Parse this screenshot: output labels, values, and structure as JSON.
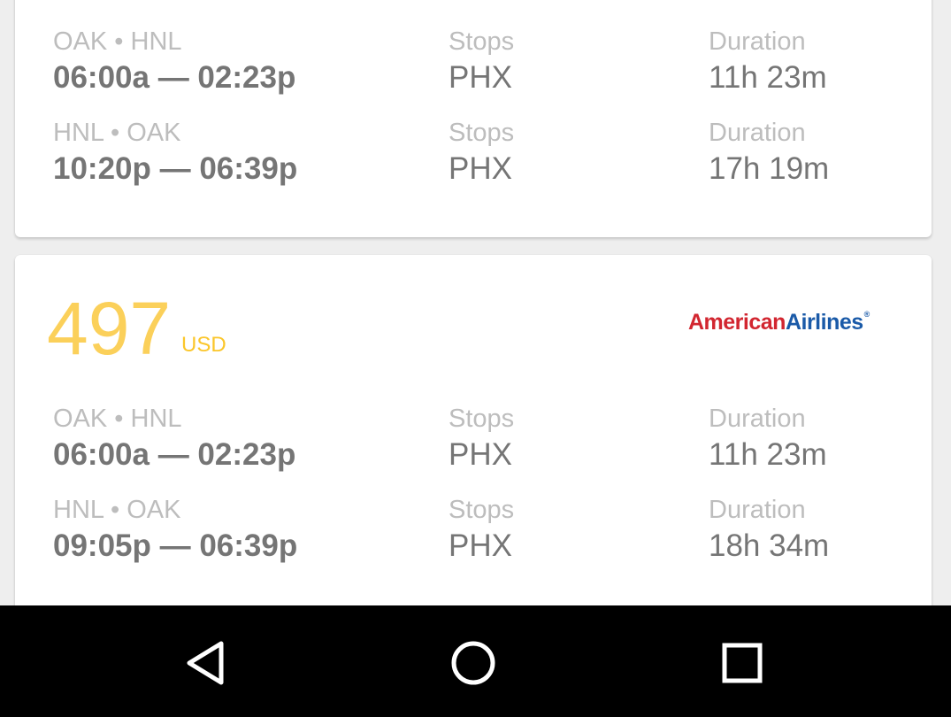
{
  "cards": [
    {
      "legs": [
        {
          "route": "OAK • HNL",
          "times": "06:00a — 02:23p",
          "stops_label": "Stops",
          "stops": "PHX",
          "duration_label": "Duration",
          "duration": "11h 23m"
        },
        {
          "route": "HNL • OAK",
          "times": "10:20p — 06:39p",
          "stops_label": "Stops",
          "stops": "PHX",
          "duration_label": "Duration",
          "duration": "17h 19m"
        }
      ]
    },
    {
      "price": "497",
      "currency": "USD",
      "airline_logo_text": [
        "American",
        "Airlines",
        "®"
      ],
      "legs": [
        {
          "route": "OAK • HNL",
          "times": "06:00a — 02:23p",
          "stops_label": "Stops",
          "stops": "PHX",
          "duration_label": "Duration",
          "duration": "11h 23m"
        },
        {
          "route": "HNL • OAK",
          "times": "09:05p — 06:39p",
          "stops_label": "Stops",
          "stops": "PHX",
          "duration_label": "Duration",
          "duration": "18h 34m"
        }
      ]
    }
  ],
  "colors": {
    "price": "#fbd05a",
    "airline_red": "#d22630",
    "airline_blue": "#1a5aa8",
    "text_secondary": "#bdbdbd",
    "text_primary": "#757575"
  },
  "navbar": {
    "icons": [
      "back-triangle-icon",
      "home-circle-icon",
      "recents-square-icon"
    ]
  }
}
